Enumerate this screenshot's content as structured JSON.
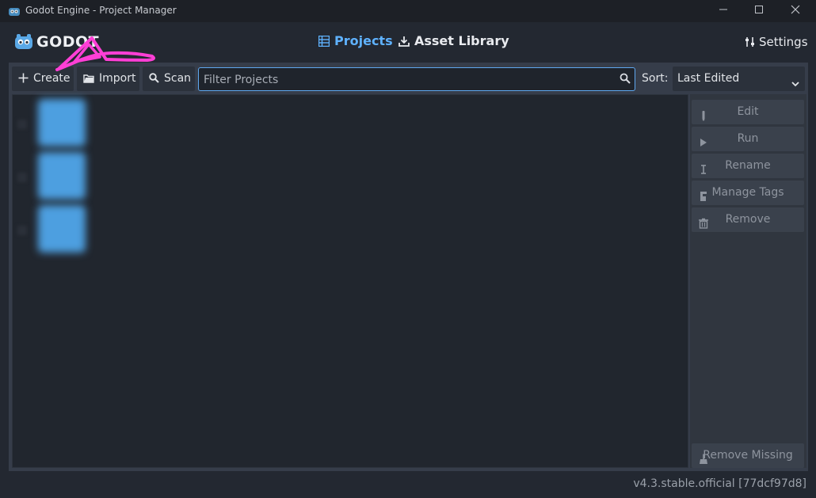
{
  "window": {
    "title": "Godot Engine - Project Manager",
    "icons": {
      "app": "godot-icon",
      "minimize": "minimize-icon",
      "maximize": "maximize-icon",
      "close": "close-icon"
    }
  },
  "header": {
    "logo_text": "GODOT",
    "tabs": [
      {
        "label": "Projects",
        "icon": "projects-list-icon",
        "active": true
      },
      {
        "label": "Asset Library",
        "icon": "download-icon",
        "active": false
      }
    ],
    "settings_label": "Settings"
  },
  "toolbar": {
    "create_label": "Create",
    "import_label": "Import",
    "scan_label": "Scan",
    "filter_placeholder": "Filter Projects",
    "sort_label": "Sort:",
    "sort_value": "Last Edited"
  },
  "projects": [
    {
      "name": "",
      "path": "",
      "modified": ""
    },
    {
      "name": "",
      "path": "",
      "modified": ""
    },
    {
      "name": "",
      "path": "",
      "modified": ""
    }
  ],
  "sidebar": {
    "edit_label": "Edit",
    "run_label": "Run",
    "rename_label": "Rename",
    "manage_tags_label": "Manage Tags",
    "remove_label": "Remove",
    "remove_missing_label": "Remove Missing"
  },
  "footer": {
    "version": "v4.3.stable.official [77dcf97d8]"
  },
  "colors": {
    "accent": "#5fb2ff",
    "annotation": "#ff3fd6",
    "panel": "#363d4a",
    "background": "#232831"
  }
}
